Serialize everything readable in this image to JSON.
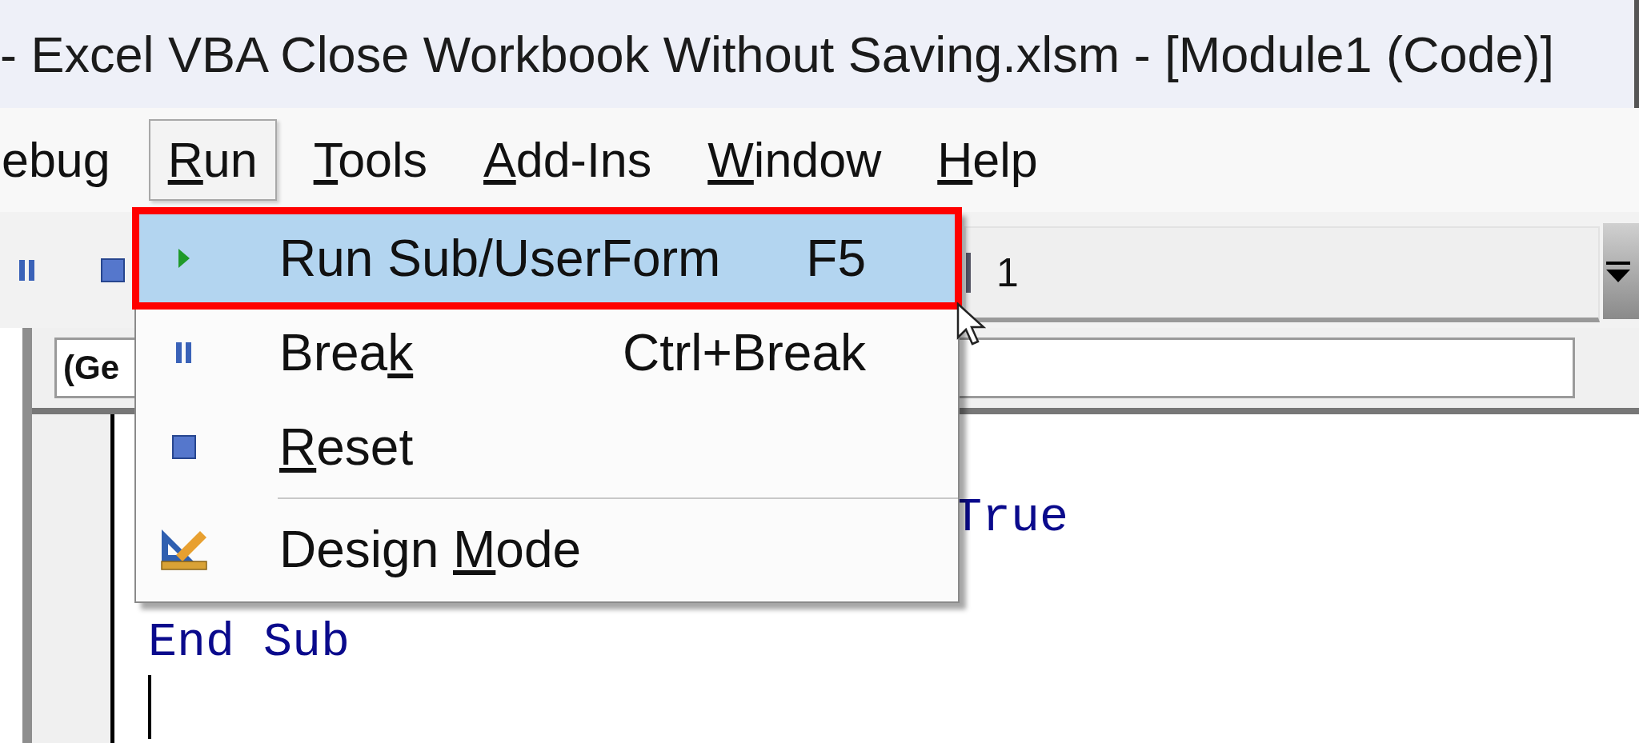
{
  "window": {
    "title": "- Excel VBA Close Workbook Without Saving.xlsm - [Module1 (Code)]"
  },
  "menu_bar": [
    {
      "pre": "ebug",
      "selected": false
    },
    {
      "key": "R",
      "post": "un",
      "selected": true
    },
    {
      "key": "T",
      "post": "ools",
      "selected": false
    },
    {
      "key": "A",
      "post": "dd-Ins",
      "selected": false
    },
    {
      "key": "W",
      "post": "indow",
      "selected": false
    },
    {
      "key": "H",
      "post": "elp",
      "selected": false
    }
  ],
  "toolbar": {
    "combo_value": "1"
  },
  "code_window": {
    "procedure_box": "(Ge",
    "lines": [
      {
        "text": "True",
        "kind": "covered"
      },
      {
        "text": "End Sub",
        "kind": "plain"
      }
    ]
  },
  "run_menu": [
    {
      "kind": "run",
      "pre": "Run Sub/UserForm",
      "shortcut": "F5",
      "selected": true,
      "highlighted": true
    },
    {
      "kind": "break",
      "pre": "Brea",
      "key": "k",
      "shortcut": "Ctrl+Break",
      "selected": false,
      "highlighted": false
    },
    {
      "kind": "reset",
      "key": "R",
      "post": "eset",
      "selected": false,
      "highlighted": false
    },
    {
      "kind": "separator"
    },
    {
      "kind": "design",
      "pre": "Design ",
      "key": "M",
      "post": "ode",
      "selected": false,
      "highlighted": false
    }
  ]
}
